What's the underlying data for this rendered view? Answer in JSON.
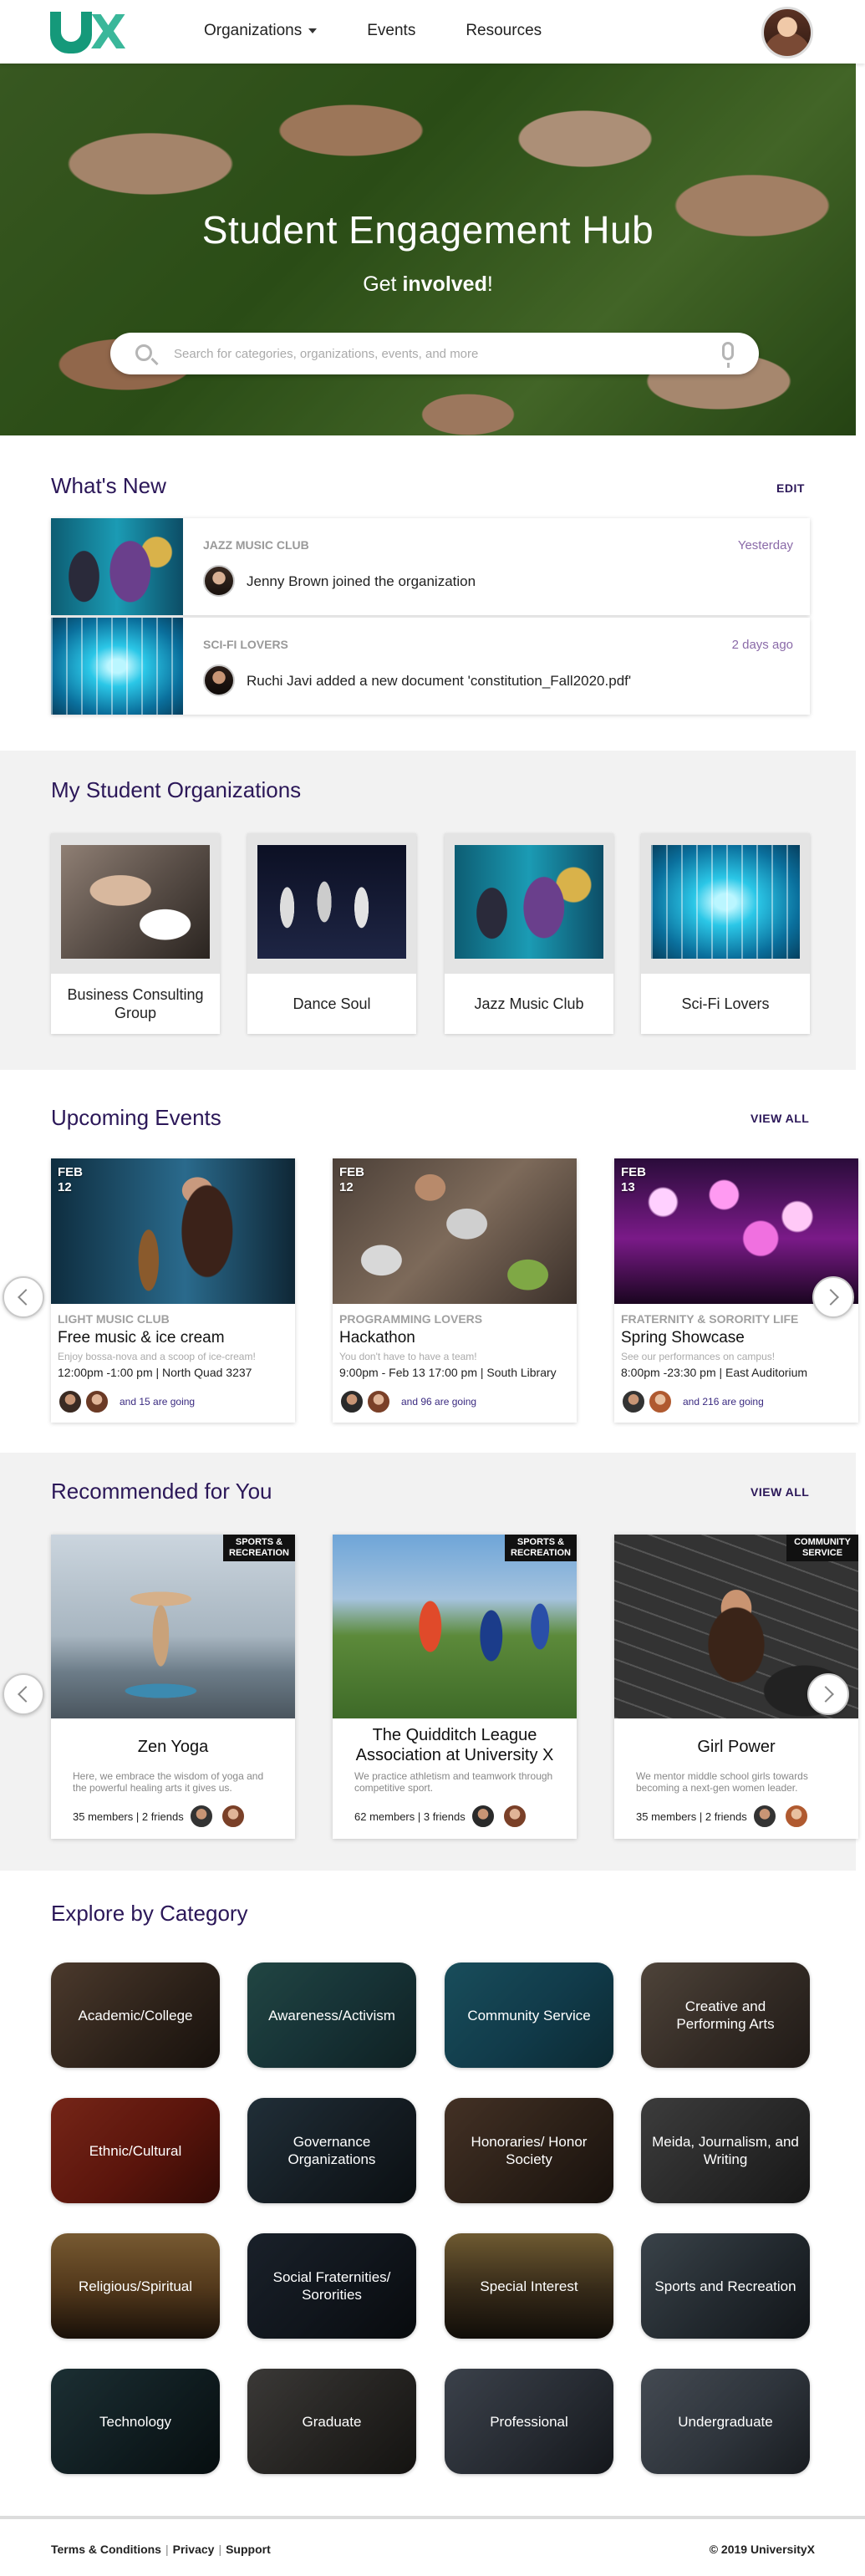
{
  "header": {
    "nav": [
      "Organizations",
      "Events",
      "Resources"
    ]
  },
  "hero": {
    "title": "Student Engagement Hub",
    "sub_prefix": "Get ",
    "sub_bold": "involved",
    "sub_suffix": "!",
    "search_placeholder": "Search for categories, organizations, events, and more"
  },
  "whats_new": {
    "title": "What's New",
    "edit_label": "EDIT",
    "items": [
      {
        "group": "JAZZ MUSIC CLUB",
        "time": "Yesterday",
        "text": "Jenny Brown joined the organization"
      },
      {
        "group": "SCI-FI LOVERS",
        "time": "2 days ago",
        "text": "Ruchi Javi added a new document 'constitution_Fall2020.pdf'"
      }
    ]
  },
  "orgs": {
    "title": "My Student Organizations",
    "items": [
      "Business Consulting Group",
      "Dance Soul",
      "Jazz Music Club",
      "Sci-Fi Lovers"
    ]
  },
  "events": {
    "title": "Upcoming Events",
    "view_all": "VIEW ALL",
    "items": [
      {
        "month": "FEB",
        "day": "12",
        "group": "LIGHT MUSIC CLUB",
        "title": "Free music & ice cream",
        "desc": "Enjoy bossa-nova and a scoop of ice-cream!",
        "when": "12:00pm -1:00 pm | North Quad 3237",
        "going": "and 15 are going"
      },
      {
        "month": "FEB",
        "day": "12",
        "group": "PROGRAMMING LOVERS",
        "title": "Hackathon",
        "desc": "You don't have to have a team!",
        "when": "9:00pm - Feb 13 17:00 pm | South Library",
        "going": "and 96 are going"
      },
      {
        "month": "FEB",
        "day": "13",
        "group": "FRATERNITY & SORORITY LIFE",
        "title": "Spring Showcase",
        "desc": "See our performances on campus!",
        "when": "8:00pm -23:30 pm | East Auditorium",
        "going": "and 216 are going"
      }
    ]
  },
  "recommended": {
    "title": "Recommended for You",
    "view_all": "VIEW ALL",
    "items": [
      {
        "badge_line1": "SPORTS &",
        "badge_line2": "RECREATION",
        "title": "Zen Yoga",
        "desc": "Here, we embrace the wisdom of yoga and the powerful healing arts it gives us.",
        "meta": "35 members | 2 friends"
      },
      {
        "badge_line1": "SPORTS &",
        "badge_line2": "RECREATION",
        "title": "The Quidditch League Association at University X",
        "desc": "We practice athletism and teamwork through competitive sport.",
        "meta": "62 members | 3 friends"
      },
      {
        "badge_line1": "COMMUNITY",
        "badge_line2": "SERVICE",
        "title": "Girl Power",
        "desc": "We mentor middle school girls towards becoming a next-gen women leader.",
        "meta": "35 members | 2 friends"
      }
    ]
  },
  "categories": {
    "title": "Explore by Category",
    "items": [
      "Academic/College",
      "Awareness/Activism",
      "Community Service",
      "Creative and Performing Arts",
      "Ethnic/Cultural",
      "Governance Organizations",
      "Honoraries/ Honor Society",
      "Meida, Journalism, and Writing",
      "Religious/Spiritual",
      "Social Fraternities/ Sororities",
      "Special Interest",
      "Sports and Recreation",
      "Technology",
      "Graduate",
      "Professional",
      "Undergraduate"
    ]
  },
  "footer": {
    "links": [
      "Terms & Conditions",
      "Privacy",
      "Support"
    ],
    "copyright": "© 2019 UniversityX"
  },
  "colors": {
    "brand_teal": "#15997a",
    "heading_purple": "#2b1758"
  },
  "icons": [
    "search-icon",
    "microphone-icon",
    "chevron-left-icon",
    "chevron-right-icon",
    "caret-down-icon"
  ]
}
